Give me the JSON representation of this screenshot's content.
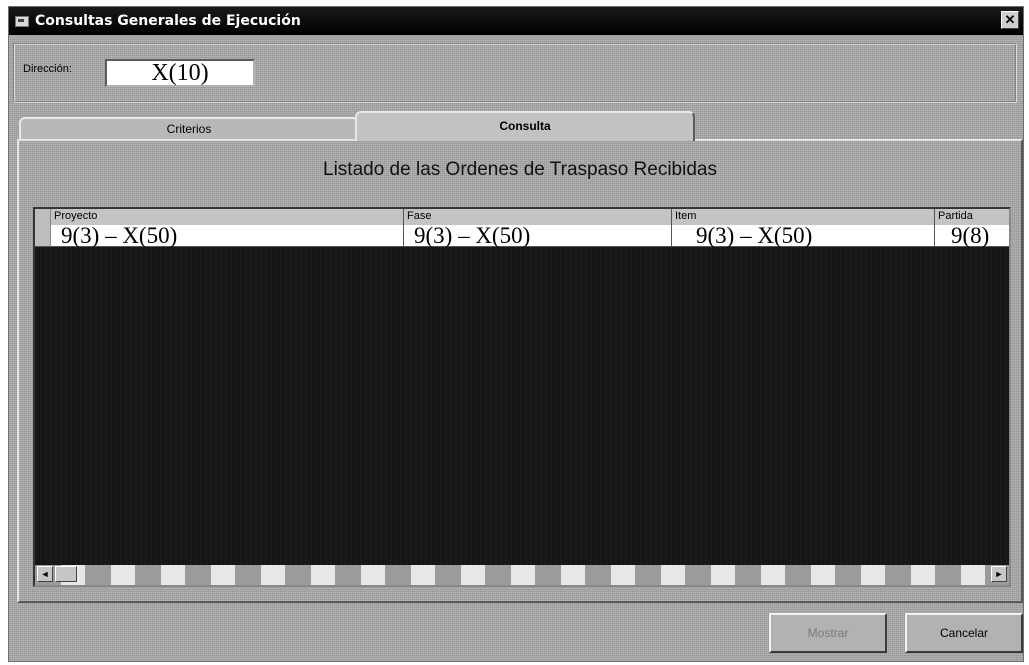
{
  "window": {
    "title": "Consultas Generales de Ejecución",
    "close_label": "✕"
  },
  "direccion": {
    "label": "Dirección:",
    "value": "X(10)"
  },
  "tabs": [
    {
      "label": "Criterios",
      "active": false
    },
    {
      "label": "Consulta",
      "active": true
    }
  ],
  "panel": {
    "title": "Listado de las Ordenes de Traspaso Recibidas"
  },
  "grid": {
    "columns": [
      "Proyecto",
      "Fase",
      "Item",
      "Partida"
    ],
    "rows": [
      [
        "9(3) – X(50)",
        "9(3) – X(50)",
        "9(3) – X(50)",
        "9(8)"
      ]
    ]
  },
  "scrollbar": {
    "left_arrow": "◄",
    "right_arrow": "►"
  },
  "buttons": {
    "mostrar": "Mostrar",
    "cancelar": "Cancelar"
  }
}
